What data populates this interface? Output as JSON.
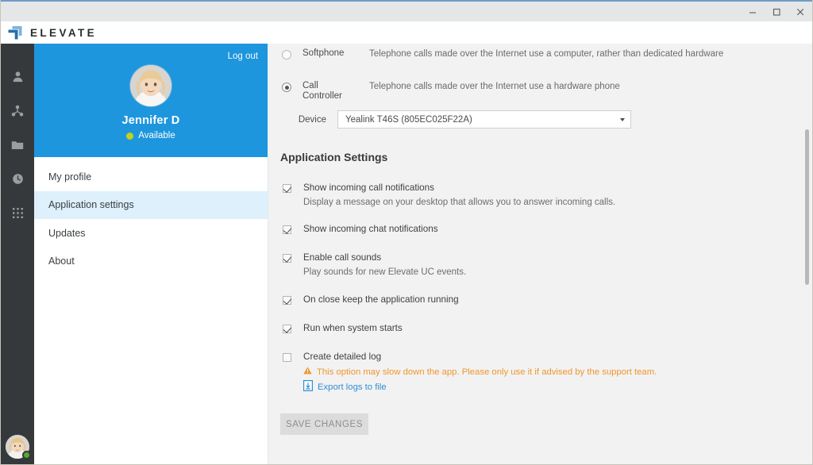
{
  "window": {
    "top_border_color": "#6f9bc8",
    "controls": [
      {
        "name": "minimize",
        "label": "Minimize"
      },
      {
        "name": "maximize",
        "label": "Maximize"
      },
      {
        "name": "close",
        "label": "Close"
      }
    ]
  },
  "brand": {
    "name": "ELEVATE",
    "logo_icon": "elevate-logo-icon",
    "logo_colors": {
      "back": "#79b4e0",
      "front": "#2b6fa8"
    }
  },
  "rail": {
    "items": [
      {
        "icon": "person-icon",
        "label": "Contacts"
      },
      {
        "icon": "group-contacts-icon",
        "label": "Groups"
      },
      {
        "icon": "folder-icon",
        "label": "Files"
      },
      {
        "icon": "clock-history-icon",
        "label": "History"
      },
      {
        "icon": "dialpad-icon",
        "label": "Dialpad"
      }
    ],
    "avatar": {
      "icon": "user-avatar-icon",
      "presence": "online",
      "presence_color": "#5aa630"
    }
  },
  "profile": {
    "logout_label": "Log out",
    "name": "Jennifer D",
    "status": "Available",
    "status_color": "#c6d11e",
    "card_color": "#1e96dd",
    "avatar_icon": "user-avatar-icon"
  },
  "menu": {
    "items": [
      {
        "label": "My profile",
        "active": false
      },
      {
        "label": "Application settings",
        "active": true
      },
      {
        "label": "Updates",
        "active": false
      },
      {
        "label": "About",
        "active": false
      }
    ],
    "active_bg": "#ddf0fb"
  },
  "phone_mode": {
    "softphone": {
      "label": "Softphone",
      "description": "Telephone calls made over the Internet use a computer, rather than dedicated hardware",
      "selected": false
    },
    "call_controller": {
      "label_line1": "Call",
      "label_line2": "Controller",
      "description": "Telephone calls made over the Internet use a hardware phone",
      "selected": true
    },
    "device": {
      "label": "Device",
      "value": "Yealink T46S (805EC025F22A)",
      "caret_icon": "chevron-down-icon"
    }
  },
  "application_settings": {
    "title": "Application Settings",
    "options": [
      {
        "label": "Show incoming call notifications",
        "sub": "Display a message on your desktop that allows you to answer incoming calls.",
        "checked": true
      },
      {
        "label": "Show incoming chat notifications",
        "sub": "",
        "checked": true
      },
      {
        "label": "Enable call sounds",
        "sub": "Play sounds for new Elevate UC events.",
        "checked": true
      },
      {
        "label": "On close keep the application running",
        "sub": "",
        "checked": true
      },
      {
        "label": "Run when system starts",
        "sub": "",
        "checked": true
      }
    ],
    "detailed_log": {
      "label": "Create detailed log",
      "checked": false,
      "warning_icon": "warning-triangle-icon",
      "warning_color": "#f0962c",
      "warning_text": "This option may slow down the app. Please only use it if advised by the support team.",
      "export_icon": "document-download-icon",
      "export_label": "Export logs to file",
      "export_color": "#2e8fd4"
    },
    "save_label": "SAVE CHANGES",
    "save_enabled": false
  }
}
